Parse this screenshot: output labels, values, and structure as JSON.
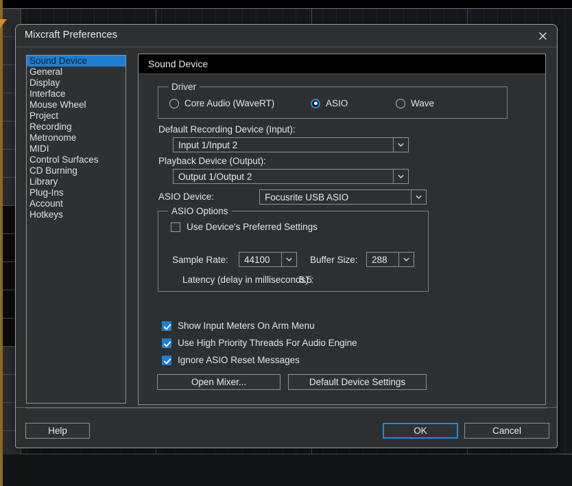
{
  "window": {
    "title": "Mixcraft Preferences",
    "close_icon": "close-icon"
  },
  "sidebar": {
    "items": [
      {
        "label": "Sound Device",
        "selected": true
      },
      {
        "label": "General",
        "selected": false
      },
      {
        "label": "Display",
        "selected": false
      },
      {
        "label": "Interface",
        "selected": false
      },
      {
        "label": "Mouse Wheel",
        "selected": false
      },
      {
        "label": "Project",
        "selected": false
      },
      {
        "label": "Recording",
        "selected": false
      },
      {
        "label": "Metronome",
        "selected": false
      },
      {
        "label": "MIDI",
        "selected": false
      },
      {
        "label": "Control Surfaces",
        "selected": false
      },
      {
        "label": "CD Burning",
        "selected": false
      },
      {
        "label": "Library",
        "selected": false
      },
      {
        "label": "Plug-Ins",
        "selected": false
      },
      {
        "label": "Account",
        "selected": false
      },
      {
        "label": "Hotkeys",
        "selected": false
      }
    ]
  },
  "panel": {
    "header": "Sound Device",
    "driver": {
      "legend": "Driver",
      "options": [
        {
          "label": "Core Audio (WaveRT)",
          "checked": false
        },
        {
          "label": "ASIO",
          "checked": true
        },
        {
          "label": "Wave",
          "checked": false
        }
      ]
    },
    "recording_device": {
      "label": "Default Recording Device (Input):",
      "value": "Input 1/Input 2"
    },
    "playback_device": {
      "label": "Playback Device (Output):",
      "value": "Output 1/Output 2"
    },
    "asio_device": {
      "label": "ASIO Device:",
      "value": "Focusrite USB ASIO"
    },
    "asio_options": {
      "legend": "ASIO Options",
      "preferred_settings": {
        "label": "Use Device's Preferred Settings",
        "checked": false
      },
      "sample_rate": {
        "label": "Sample Rate:",
        "value": "44100"
      },
      "buffer_size": {
        "label": "Buffer Size:",
        "value": "288"
      },
      "latency": {
        "label": "Latency (delay in milliseconds) :",
        "value": "6.5"
      }
    },
    "checkboxes": [
      {
        "label": "Show Input Meters On Arm Menu",
        "checked": true
      },
      {
        "label": "Use High Priority Threads For Audio Engine",
        "checked": true
      },
      {
        "label": "Ignore ASIO Reset Messages",
        "checked": true
      }
    ],
    "open_mixer_button": "Open Mixer...",
    "default_device_button": "Default Device Settings"
  },
  "footer": {
    "help_button": "Help",
    "ok_button": "OK",
    "cancel_button": "Cancel"
  },
  "colors": {
    "accent_blue": "#1b7fd4",
    "focus_blue": "#1b8fe0",
    "dialog_bg": "#2e2f31",
    "panel_header_bg": "#000000",
    "text": "#e3e5e7"
  }
}
